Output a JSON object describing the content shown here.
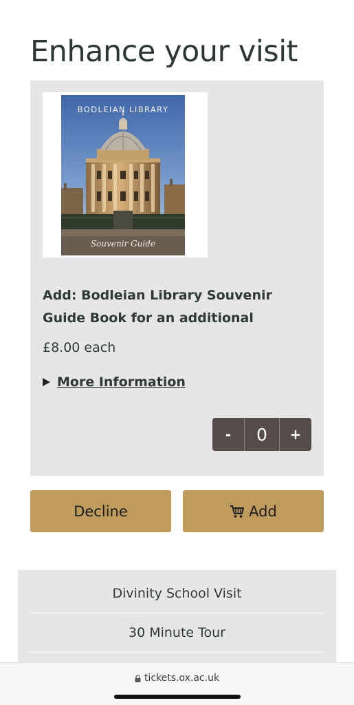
{
  "page": {
    "title": "Enhance your visit"
  },
  "upsell": {
    "image": {
      "cover_title": "BODLEIAN LIBRARY",
      "cover_subtitle": "Souvenir Guide"
    },
    "product_name": "Add: Bodleian Library Souvenir Guide Book for an additional",
    "price": "£8.00 each",
    "more_info_label": "More Information",
    "quantity": {
      "decrement_label": "-",
      "value": "0",
      "increment_label": "+"
    }
  },
  "actions": {
    "decline_label": "Decline",
    "add_label": "Add",
    "add_icon": "cart-icon"
  },
  "other_tickets": {
    "items": [
      {
        "label": "Divinity School Visit"
      },
      {
        "label": "30 Minute Tour"
      }
    ]
  },
  "browser": {
    "url": "tickets.ox.ac.uk",
    "lock_icon": "lock-icon"
  },
  "colors": {
    "accent_button": "#bf9b5e",
    "stepper": "#564c49",
    "card_background": "#e6e6e6",
    "text": "#2f3a37"
  }
}
